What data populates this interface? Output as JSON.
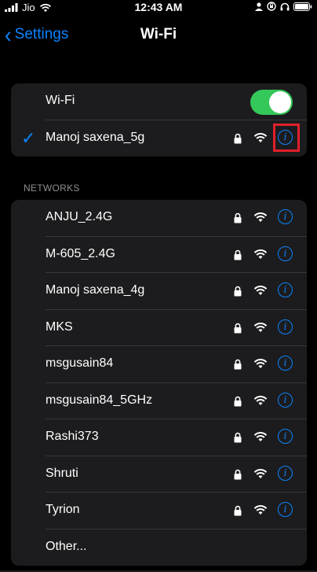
{
  "status_bar": {
    "carrier": "Jio",
    "time": "12:43 AM"
  },
  "nav": {
    "back_label": "Settings",
    "title": "Wi-Fi"
  },
  "wifi_toggle": {
    "label": "Wi-Fi",
    "on": true
  },
  "connected": {
    "name": "Manoj saxena_5g"
  },
  "networks_header": "NETWORKS",
  "networks": [
    {
      "name": "ANJU_2.4G"
    },
    {
      "name": "M-605_2.4G"
    },
    {
      "name": "Manoj saxena_4g"
    },
    {
      "name": "MKS"
    },
    {
      "name": "msgusain84"
    },
    {
      "name": "msgusain84_5GHz"
    },
    {
      "name": "Rashi373"
    },
    {
      "name": "Shruti"
    },
    {
      "name": "Tyrion"
    }
  ],
  "other_label": "Other...",
  "colors": {
    "accent": "#0a84ff",
    "toggle_on": "#34c759",
    "highlight": "#e0202a"
  },
  "icons": [
    "chevron-left-icon",
    "lock-icon",
    "wifi-icon",
    "info-icon",
    "checkmark-icon"
  ]
}
